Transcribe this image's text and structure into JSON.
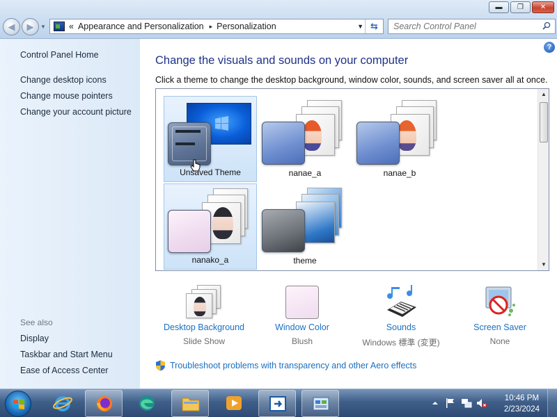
{
  "window": {
    "buttons": {
      "minimize": "▬",
      "maximize": "❐",
      "close": "✕"
    }
  },
  "address_bar": {
    "prefix": "«",
    "crumbs": [
      "Appearance and Personalization",
      "Personalization"
    ],
    "separator": "▸"
  },
  "search": {
    "placeholder": "Search Control Panel"
  },
  "sidebar": {
    "home": "Control Panel Home",
    "links": [
      "Change desktop icons",
      "Change mouse pointers",
      "Change your account picture"
    ],
    "see_also_heading": "See also",
    "see_also": [
      "Display",
      "Taskbar and Start Menu",
      "Ease of Access Center"
    ]
  },
  "main": {
    "help_label": "?",
    "heading": "Change the visuals and sounds on your computer",
    "subheading": "Click a theme to change the desktop background, window color, sounds, and screen saver all at once.",
    "themes": [
      {
        "name": "Unsaved Theme",
        "selected": true
      },
      {
        "name": "nanae_a",
        "selected": false
      },
      {
        "name": "nanae_b",
        "selected": false
      },
      {
        "name": "nanako_a",
        "selected": true
      },
      {
        "name": "theme",
        "selected": false
      }
    ]
  },
  "settings": [
    {
      "label": "Desktop Background",
      "value": "Slide Show",
      "icon": "desktop-background-icon"
    },
    {
      "label": "Window Color",
      "value": "Blush",
      "icon": "window-color-icon"
    },
    {
      "label": "Sounds",
      "value": "Windows 標準 (変更)",
      "icon": "sounds-icon"
    },
    {
      "label": "Screen Saver",
      "value": "None",
      "icon": "screen-saver-icon"
    }
  ],
  "troubleshoot": "Troubleshoot problems with transparency and other Aero effects",
  "taskbar": {
    "apps": [
      "internet-explorer",
      "firefox",
      "edge",
      "file-explorer",
      "media-player",
      "remote-app",
      "control-panel"
    ],
    "clock_time": "10:46 PM",
    "clock_date": "2/23/2024"
  },
  "colors": {
    "heading": "#1e3287",
    "link": "#1a6fc1",
    "taskbar": "#3f5f89"
  }
}
